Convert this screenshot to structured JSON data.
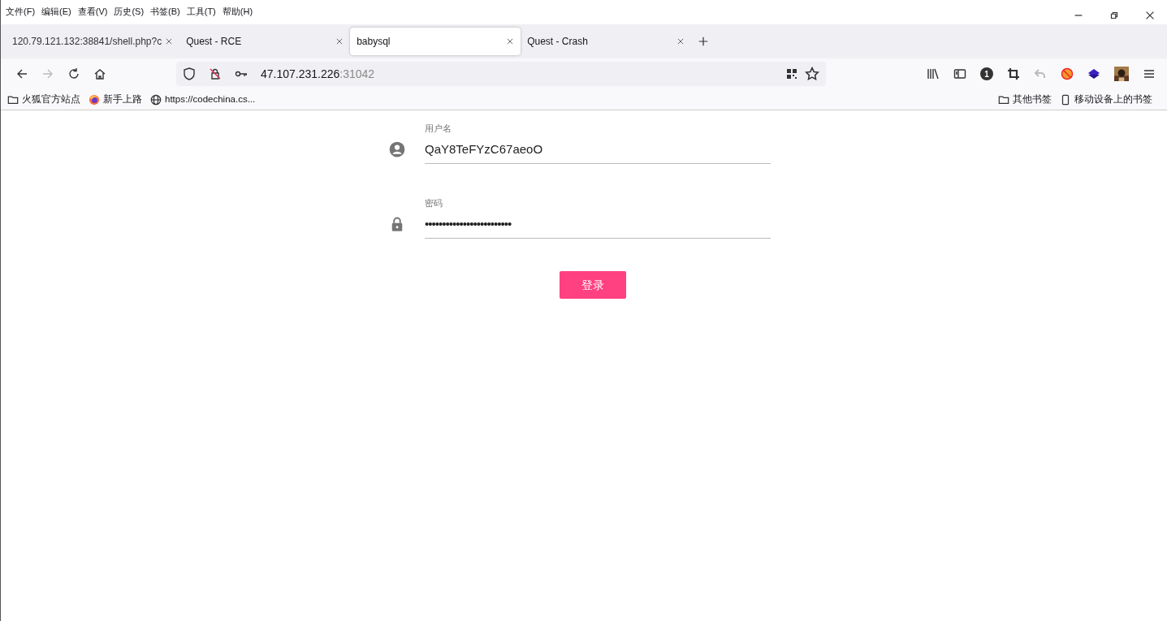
{
  "menu_bar": [
    "文件(F)",
    "编辑(E)",
    "查看(V)",
    "历史(S)",
    "书签(B)",
    "工具(T)",
    "帮助(H)"
  ],
  "tabs": [
    {
      "label": "120.79.121.132:38841/shell.php?c",
      "selected": false
    },
    {
      "label": "Quest - RCE",
      "selected": false
    },
    {
      "label": "babysql",
      "selected": true
    },
    {
      "label": "Quest - Crash",
      "selected": false
    }
  ],
  "nav": {
    "back_disabled": false,
    "forward_disabled": true
  },
  "address_bar": {
    "host": "47.107.231.226",
    "port": ":31042"
  },
  "toolbar": {
    "badge": "1"
  },
  "bookmarks": [
    "火狐官方站点",
    "新手上路",
    "https://codechina.cs..."
  ],
  "bookmarks_right": [
    "其他书签",
    "移动设备上的书签"
  ],
  "form": {
    "username": {
      "label": "用户名",
      "value": "QaY8TeFYzC67aeoO"
    },
    "password": {
      "label": "密码",
      "mask": "•••••••••••••••••••••••••"
    },
    "submit": "登录"
  }
}
